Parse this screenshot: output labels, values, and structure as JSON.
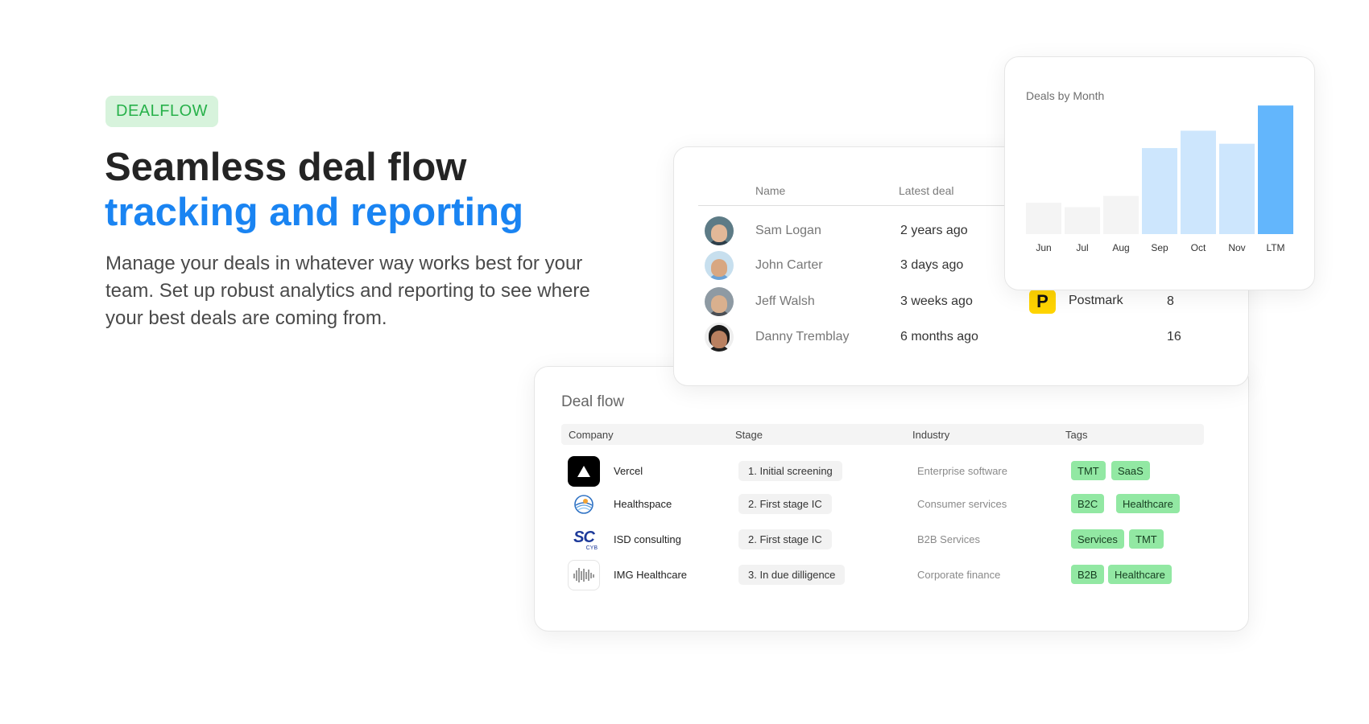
{
  "hero": {
    "badge": "DEALFLOW",
    "headline_line1": "Seamless deal flow",
    "headline_line2": "tracking and reporting",
    "description": "Manage your deals in whatever way works best for your team. Set up robust analytics and reporting to see where your best deals are coming from.",
    "colors": {
      "accent": "#1a84f2",
      "badge_bg": "#d7f3dc",
      "badge_text": "#27b14a"
    }
  },
  "people": {
    "headers": {
      "name": "Name",
      "latest_deal": "Latest deal"
    },
    "rows": [
      {
        "name": "Sam Logan",
        "latest_deal": "2 years ago",
        "company": "",
        "count": ""
      },
      {
        "name": "John Carter",
        "latest_deal": "3 days ago",
        "company": "",
        "count": ""
      },
      {
        "name": "Jeff Walsh",
        "latest_deal": "3 weeks ago",
        "company": "Postmark",
        "company_logo": "P",
        "count": "8"
      },
      {
        "name": "Danny Tremblay",
        "latest_deal": "6 months ago",
        "company": "",
        "count": "16"
      }
    ]
  },
  "chart_data": {
    "type": "bar",
    "title": "Deals by Month",
    "categories": [
      "Jun",
      "Jul",
      "Aug",
      "Sep",
      "Oct",
      "Nov",
      "LTM"
    ],
    "values": [
      36,
      31,
      44,
      99,
      119,
      104,
      148
    ],
    "ylim": [
      0,
      150
    ],
    "grid": false,
    "colors": {
      "past": "#f4f4f4",
      "recent": "#cde6fd",
      "highlight": "#63b6fc"
    },
    "bar_colors": [
      "past",
      "past",
      "past",
      "recent",
      "recent",
      "recent",
      "highlight"
    ]
  },
  "deal_flow": {
    "title": "Deal flow",
    "headers": {
      "company": "Company",
      "stage": "Stage",
      "industry": "Industry",
      "tags": "Tags"
    },
    "rows": [
      {
        "company": "Vercel",
        "logo_icon": "vercel-triangle-icon",
        "stage": "1. Initial screening",
        "industry": "Enterprise software",
        "tags": [
          "TMT",
          "SaaS"
        ]
      },
      {
        "company": "Healthspace",
        "logo_icon": "healthspace-globe-icon",
        "stage": "2. First stage IC",
        "industry": "Consumer services",
        "tags": [
          "B2C",
          "Healthcare"
        ]
      },
      {
        "company": "ISD consulting",
        "logo_icon": "isd-sc-logo",
        "logo_text": "SC",
        "logo_subtext": "CYB",
        "stage": "2. First stage IC",
        "industry": "B2B Services",
        "tags": [
          "Services",
          "TMT"
        ]
      },
      {
        "company": "IMG Healthcare",
        "logo_icon": "img-waveform-icon",
        "stage": "3. In due dilligence",
        "industry": "Corporate finance",
        "tags": [
          "B2B",
          "Healthcare"
        ]
      }
    ],
    "colors": {
      "tag_bg": "#92e8a3"
    }
  }
}
